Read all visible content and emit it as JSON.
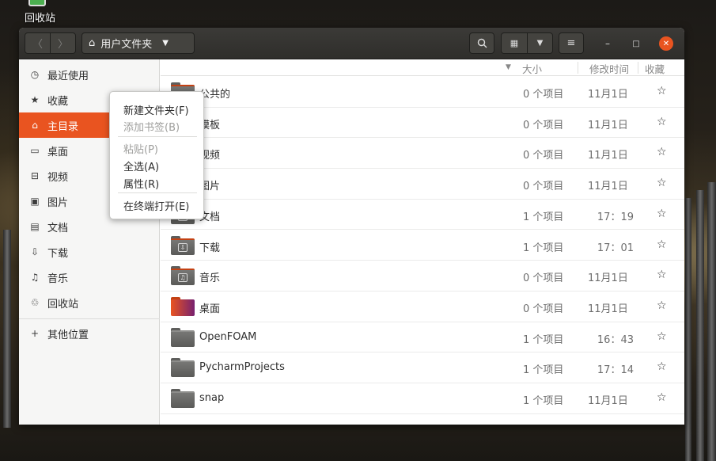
{
  "desktop": {
    "trash_label": "回收站"
  },
  "headerbar": {
    "back_icon": "chevron-left-icon",
    "forward_icon": "chevron-right-icon",
    "path_label": "用户文件夹",
    "path_icon": "home-icon"
  },
  "sidebar": {
    "items": [
      {
        "label": "最近使用",
        "icon": "clock-icon"
      },
      {
        "label": "收藏",
        "icon": "star-icon"
      },
      {
        "label": "主目录",
        "icon": "home-icon"
      },
      {
        "label": "桌面",
        "icon": "desktop-icon"
      },
      {
        "label": "视频",
        "icon": "film-icon"
      },
      {
        "label": "图片",
        "icon": "image-icon"
      },
      {
        "label": "文档",
        "icon": "document-icon"
      },
      {
        "label": "下载",
        "icon": "download-icon"
      },
      {
        "label": "音乐",
        "icon": "music-icon"
      },
      {
        "label": "回收站",
        "icon": "trash-icon"
      },
      {
        "label": "其他位置",
        "icon": "plus-icon"
      }
    ],
    "active_index": 2
  },
  "columns": {
    "size": "大小",
    "modified": "修改时间",
    "starred": "收藏"
  },
  "files": [
    {
      "name": "公共的",
      "size": "0 个项目",
      "modified": "11月1日"
    },
    {
      "name": "模板",
      "size": "0 个项目",
      "modified": "11月1日"
    },
    {
      "name": "视频",
      "size": "0 个项目",
      "modified": "11月1日"
    },
    {
      "name": "图片",
      "size": "0 个项目",
      "modified": "11月1日"
    },
    {
      "name": "文档",
      "size": "1 个项目",
      "modified": "17：19"
    },
    {
      "name": "下载",
      "size": "1 个项目",
      "modified": "17：01"
    },
    {
      "name": "音乐",
      "size": "0 个项目",
      "modified": "11月1日"
    },
    {
      "name": "桌面",
      "size": "0 个项目",
      "modified": "11月1日"
    },
    {
      "name": "OpenFOAM",
      "size": "1 个项目",
      "modified": "16：43"
    },
    {
      "name": "PycharmProjects",
      "size": "1 个项目",
      "modified": "17：14"
    },
    {
      "name": "snap",
      "size": "1 个项目",
      "modified": "11月1日"
    }
  ],
  "context_menu": {
    "new_folder": "新建文件夹(F)",
    "add_bookmark": "添加书签(B)",
    "paste": "粘贴(P)",
    "select_all": "全选(A)",
    "properties": "属性(R)",
    "open_terminal": "在终端打开(E)"
  },
  "colors": {
    "accent": "#e95420",
    "headerbar": "#2f2e2b"
  }
}
